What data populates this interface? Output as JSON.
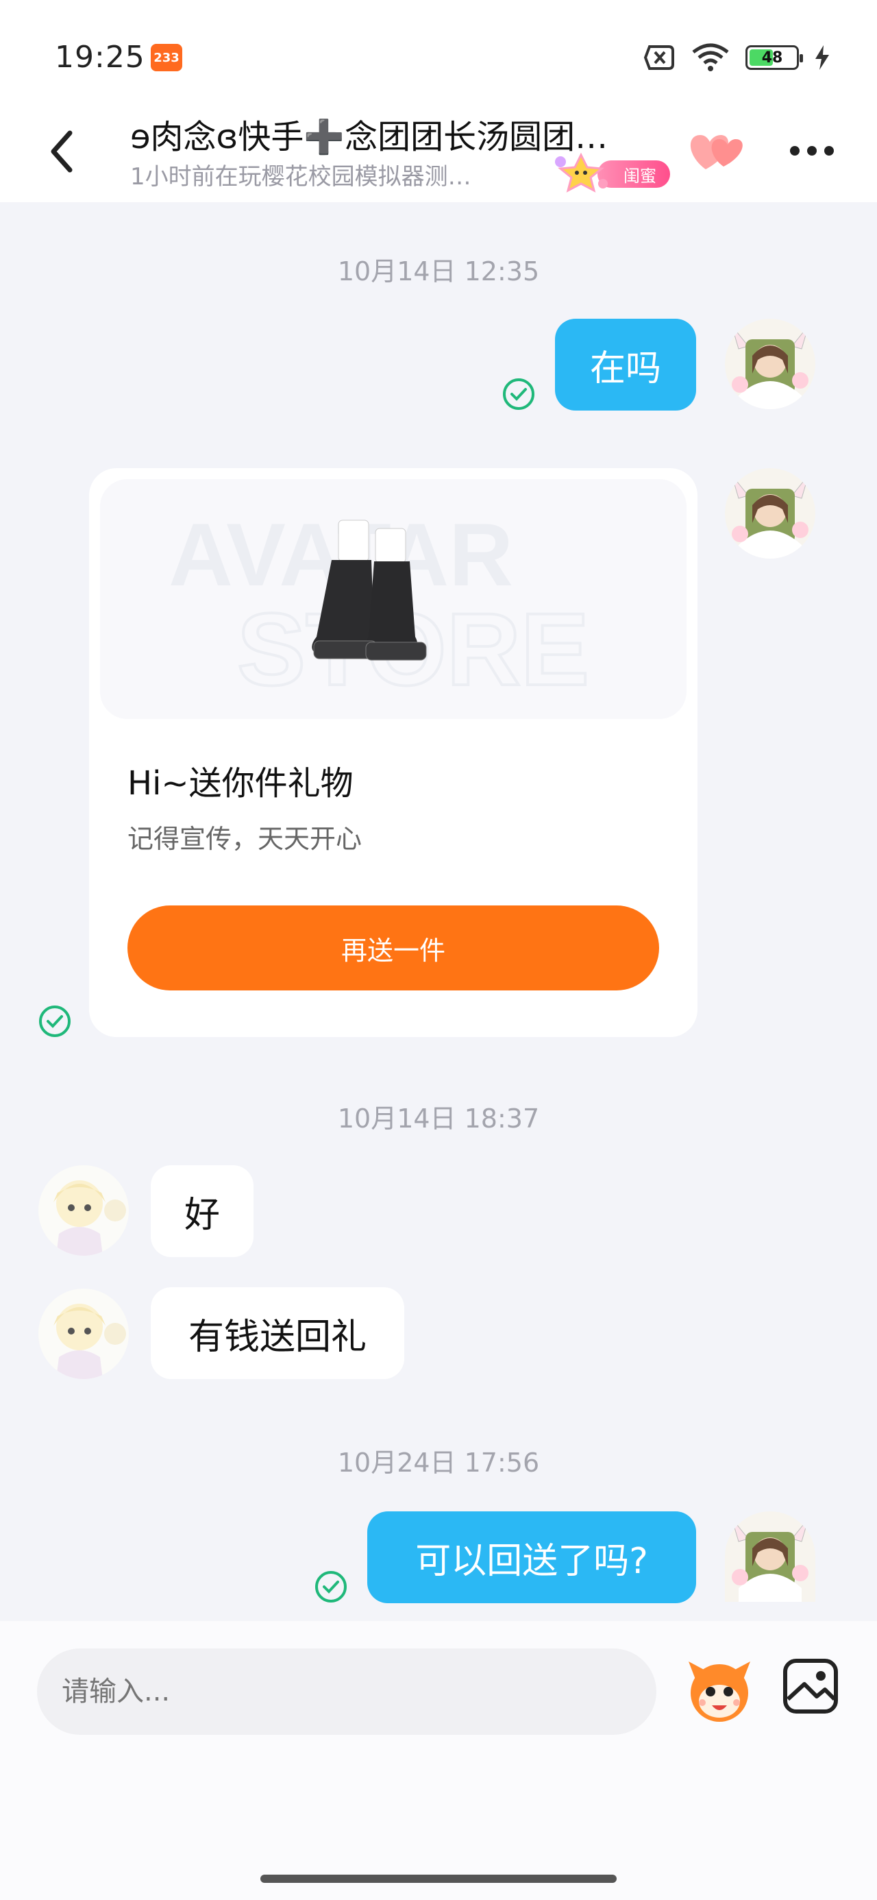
{
  "status_bar": {
    "time": "19:25",
    "app_badge": "233",
    "battery_level": "48",
    "battery_fraction": 0.48,
    "icons": [
      "no-sim-icon",
      "wifi-icon",
      "battery-icon",
      "charging-icon"
    ]
  },
  "header": {
    "title": "ɘ肉念ɞ快手➕念团团长汤圆团…",
    "subtitle": "1小时前在玩樱花校园模拟器测…",
    "relationship_tag": "闺蜜"
  },
  "messages": [
    {
      "type": "time",
      "text": "10月14日 12:35"
    },
    {
      "type": "text",
      "side": "right",
      "text": "在吗",
      "read": true
    },
    {
      "type": "gift",
      "side": "right",
      "image_watermark_1": "AVATAR",
      "image_watermark_2": "STORE",
      "title": "Hi~送你件礼物",
      "desc": "记得宣传，天天开心",
      "button": "再送一件",
      "read": true
    },
    {
      "type": "time",
      "text": "10月14日 18:37"
    },
    {
      "type": "text",
      "side": "left",
      "text": "好"
    },
    {
      "type": "text",
      "side": "left",
      "text": "有钱送回礼"
    },
    {
      "type": "time",
      "text": "10月24日 17:56"
    },
    {
      "type": "text",
      "side": "right",
      "text": "可以回送了吗?",
      "read": true
    }
  ],
  "input": {
    "placeholder": "请输入..."
  },
  "colors": {
    "my_bubble": "#2bb8f4",
    "gift_button": "#ff7414",
    "read_check": "#1fb87a",
    "background": "#f3f4f9"
  }
}
